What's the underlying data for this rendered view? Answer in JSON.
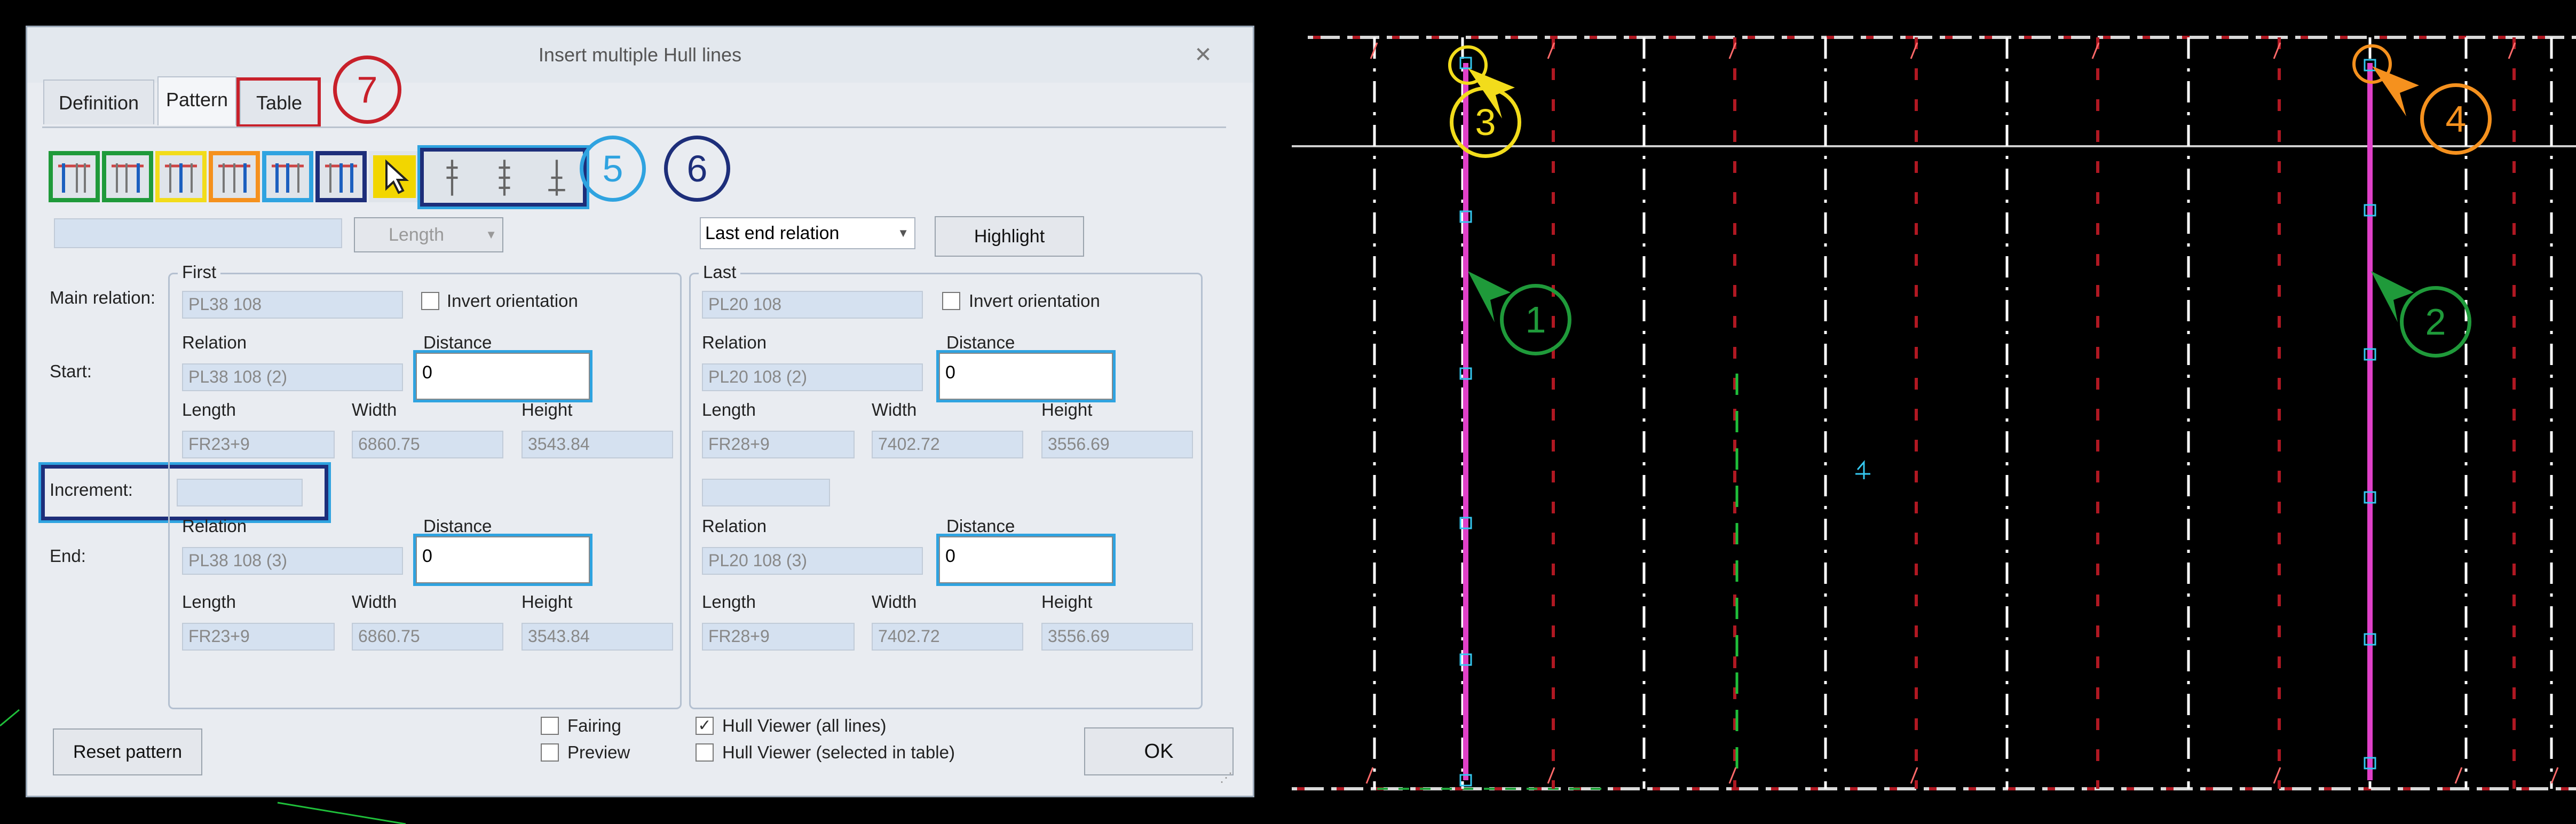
{
  "dialog": {
    "title": "Insert multiple Hull lines",
    "close_glyph": "✕",
    "tabs": [
      "Definition",
      "Pattern",
      "Table"
    ],
    "active_tab": "Pattern",
    "combo_length": "Length",
    "end_relation_select": "Last end relation",
    "highlight_button": "Highlight",
    "first": {
      "group_label": "First",
      "main_relation": "PL38 108",
      "invert_label": "Invert orientation",
      "start": {
        "relation_label": "Relation",
        "relation": "PL38 108 (2)",
        "distance_label": "Distance",
        "distance": "0",
        "length_label": "Length",
        "length": "FR23+9",
        "width_label": "Width",
        "width": "6860.75",
        "height_label": "Height",
        "height": "3543.84"
      },
      "end": {
        "relation_label": "Relation",
        "relation": "PL38 108 (3)",
        "distance_label": "Distance",
        "distance": "0",
        "length_label": "Length",
        "length": "FR23+9",
        "width_label": "Width",
        "width": "6860.75",
        "height_label": "Height",
        "height": "3543.84"
      }
    },
    "last": {
      "group_label": "Last",
      "main_relation": "PL20 108",
      "invert_label": "Invert orientation",
      "start": {
        "relation_label": "Relation",
        "relation": "PL20 108 (2)",
        "distance_label": "Distance",
        "distance": "0",
        "length_label": "Length",
        "length": "FR28+9",
        "width_label": "Width",
        "width": "7402.72",
        "height_label": "Height",
        "height": "3556.69"
      },
      "end": {
        "relation_label": "Relation",
        "relation": "PL20 108 (3)",
        "distance_label": "Distance",
        "distance": "0",
        "length_label": "Length",
        "length": "FR28+9",
        "width_label": "Width",
        "width": "7402.72",
        "height_label": "Height",
        "height": "3556.69"
      }
    },
    "row_labels": {
      "main_relation": "Main relation:",
      "start": "Start:",
      "increment": "Increment:",
      "end": "End:"
    },
    "reset_button": "Reset pattern",
    "fairing_label": "Fairing",
    "preview_label": "Preview",
    "hull_all_label": "Hull Viewer (all lines)",
    "hull_all_checked": true,
    "hull_selected_label": "Hull Viewer (selected in table)",
    "ok_button": "OK",
    "toolbar_icons": [
      "hull-line-pattern-icon-1",
      "hull-line-pattern-icon-2",
      "hull-line-pattern-icon-3",
      "hull-line-pattern-icon-4",
      "hull-line-pattern-icon-5",
      "hull-line-pattern-icon-6",
      "pointer-icon",
      "vertical-line-icon-1",
      "vertical-line-icon-2",
      "vertical-line-icon-3"
    ]
  },
  "callouts": {
    "c1": "1",
    "c2": "2",
    "c3": "3",
    "c4": "4",
    "c5": "5",
    "c6": "6",
    "c7": "7"
  },
  "colors": {
    "green": "#1f9a3a",
    "yellow": "#f2dc1b",
    "orange": "#f5911e",
    "light_blue": "#2fa3e0",
    "navy": "#1d2e7a",
    "red": "#c8202a",
    "magenta": "#e040c8"
  }
}
